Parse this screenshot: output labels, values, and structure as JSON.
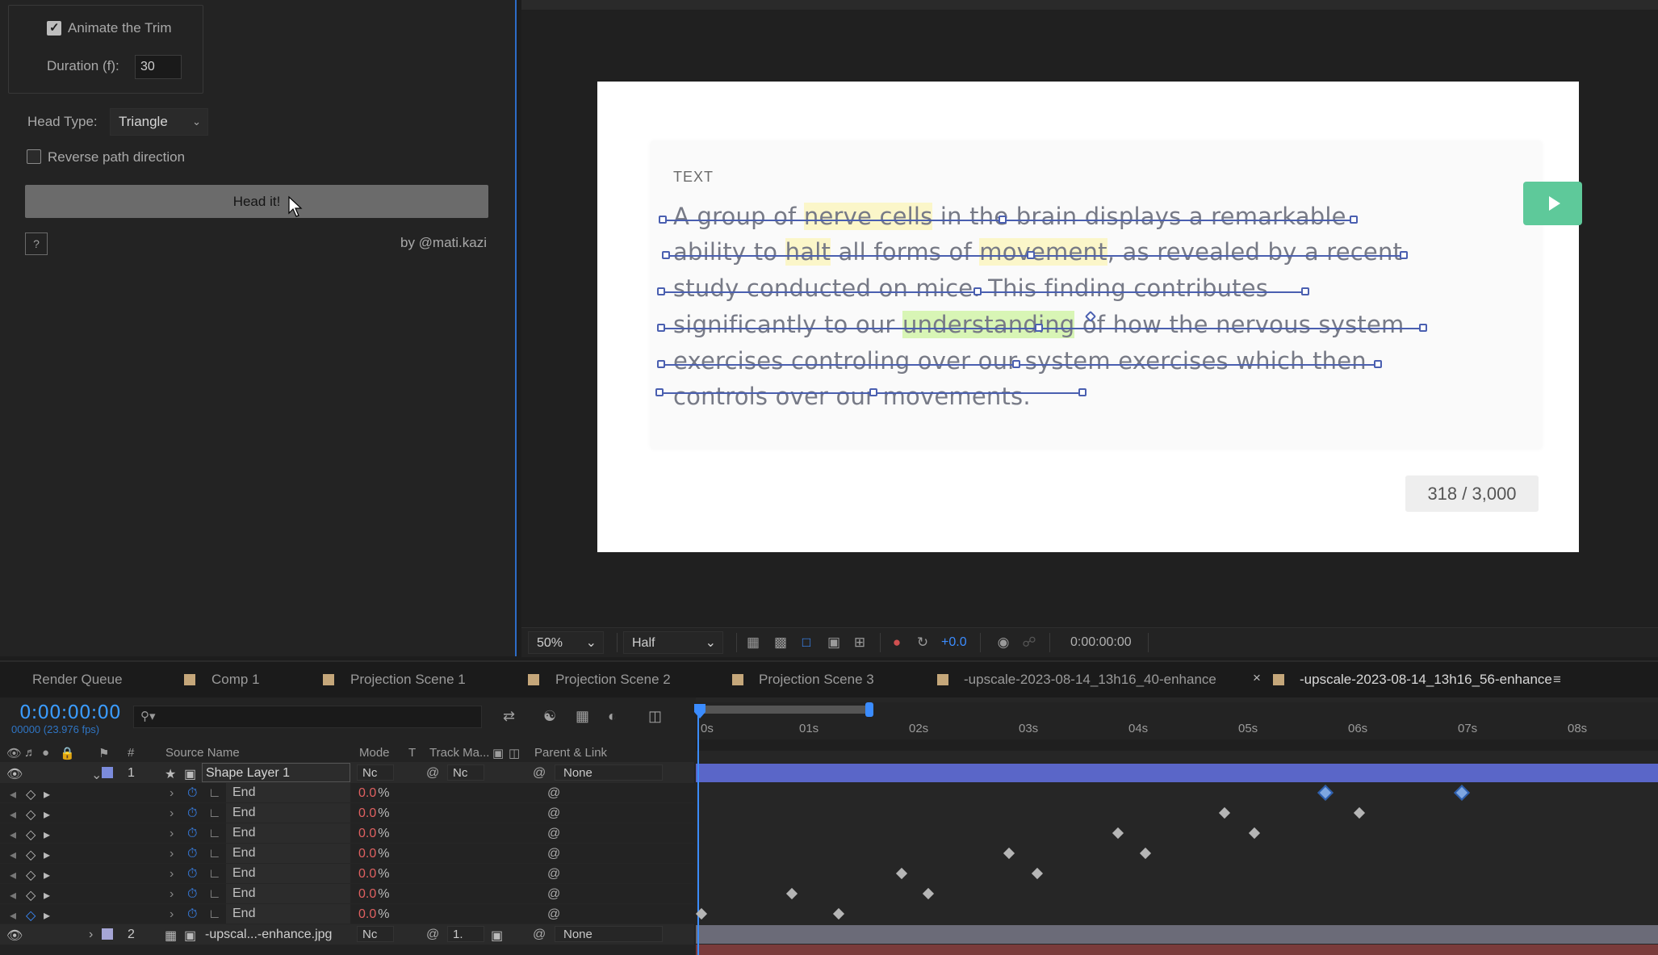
{
  "left_panel": {
    "animate_trim_label": "Animate the Trim",
    "animate_trim_checked": true,
    "duration_label": "Duration (f):",
    "duration_value": "30",
    "head_type_label": "Head Type:",
    "head_type_value": "Triangle",
    "reverse_label": "Reverse path direction",
    "reverse_checked": false,
    "head_it_label": "Head it!",
    "help_label": "?",
    "credit": "by @mati.kazi"
  },
  "composition": {
    "card_label": "TEXT",
    "lines": [
      "A group of nerve cells in the brain displays a remarkable",
      "ability to halt all forms of movement, as revealed by a recent",
      "study conducted on mice. This finding contributes",
      "significantly to our understanding of how the nervous system",
      "exercises controling over our system exercises which then",
      "controls over our movements."
    ],
    "char_count": "318 / 3,000"
  },
  "viewer_bar": {
    "zoom": "50%",
    "resolution": "Half",
    "exposure": "+0.0",
    "timecode": "0:00:00:00"
  },
  "tabs": [
    "Render Queue",
    "Comp 1",
    "Projection Scene 1",
    "Projection Scene 2",
    "Projection Scene 3",
    "-upscale-2023-08-14_13h16_40-enhance",
    "-upscale-2023-08-14_13h16_56-enhance"
  ],
  "timeline": {
    "timecode": "0:00:00:00",
    "frames": "00000 (23.976 fps)",
    "columns": {
      "num": "#",
      "source_name": "Source Name",
      "mode": "Mode",
      "t": "T",
      "track_matte": "Track Ma...",
      "parent_link": "Parent & Link"
    },
    "layer1": {
      "index": "1",
      "name": "Shape Layer 1",
      "mode": "Nc",
      "matte": "Nc",
      "parent": "None"
    },
    "properties": [
      {
        "name": "End",
        "value": "0.0",
        "unit": "%"
      },
      {
        "name": "End",
        "value": "0.0",
        "unit": "%"
      },
      {
        "name": "End",
        "value": "0.0",
        "unit": "%"
      },
      {
        "name": "End",
        "value": "0.0",
        "unit": "%"
      },
      {
        "name": "End",
        "value": "0.0",
        "unit": "%"
      },
      {
        "name": "End",
        "value": "0.0",
        "unit": "%"
      },
      {
        "name": "End",
        "value": "0.0",
        "unit": "%"
      }
    ],
    "layer2": {
      "index": "2",
      "name": "-upscal...-enhance.jpg",
      "mode": "Nc",
      "matte": "1.",
      "parent": "None"
    },
    "ruler_labels": [
      "0s",
      "01s",
      "02s",
      "03s",
      "04s",
      "05s",
      "06s",
      "07s",
      "08s"
    ]
  }
}
